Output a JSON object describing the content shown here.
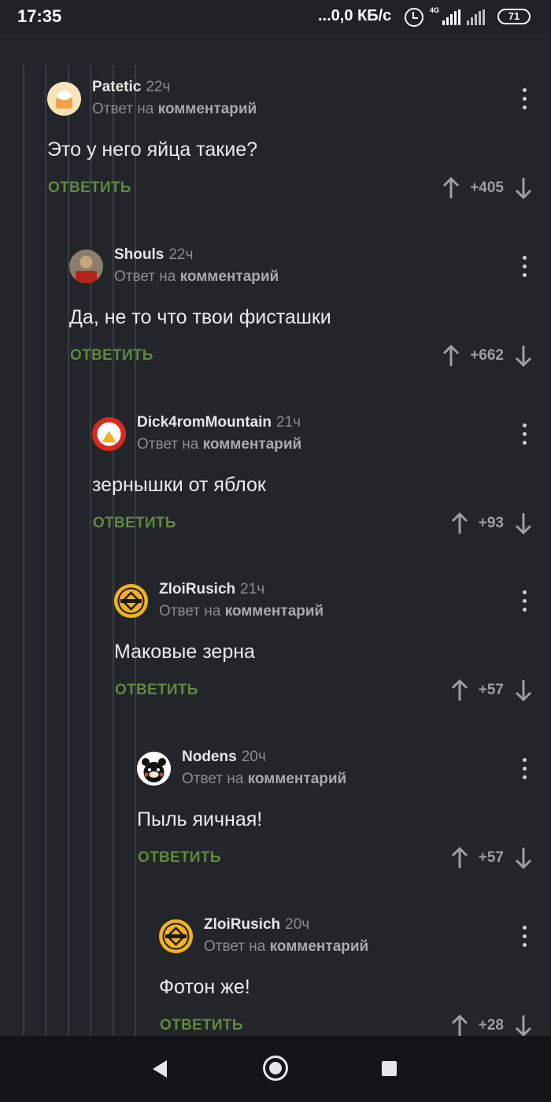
{
  "status_bar": {
    "time": "17:35",
    "network": "...0,0 КБ/с",
    "lte_label": "4G",
    "battery": "71"
  },
  "comments": [
    {
      "user": "Patetic",
      "time": "22ч",
      "reply_prefix": "Ответ на",
      "reply_target": "комментарий",
      "text": "Это у него яйца такие?",
      "reply_label": "ОТВЕТИТЬ",
      "score": "+405",
      "avatar_color": "#f3d9a2"
    },
    {
      "user": "Shouls",
      "time": "22ч",
      "reply_prefix": "Ответ на",
      "reply_target": "комментарий",
      "text": "Да, не то что твои фисташки",
      "reply_label": "ОТВЕТИТЬ",
      "score": "+662",
      "avatar_color": "#7a5a3a"
    },
    {
      "user": "Dick4romMountain",
      "time": "21ч",
      "reply_prefix": "Ответ на",
      "reply_target": "комментарий",
      "text": "зернышки от яблок",
      "reply_label": "ОТВЕТИТЬ",
      "score": "+93",
      "avatar_color": "#d92b1d"
    },
    {
      "user": "ZloiRusich",
      "time": "21ч",
      "reply_prefix": "Ответ на",
      "reply_target": "комментарий",
      "text": "Маковые зерна",
      "reply_label": "ОТВЕТИТЬ",
      "score": "+57",
      "avatar_color": "#f2b21b"
    },
    {
      "user": "Nodens",
      "time": "20ч",
      "reply_prefix": "Ответ на",
      "reply_target": "комментарий",
      "text": "Пыль яичная!",
      "reply_label": "ОТВЕТИТЬ",
      "score": "+57",
      "avatar_color": "#ffffff"
    },
    {
      "user": "ZloiRusich",
      "time": "20ч",
      "reply_prefix": "Ответ на",
      "reply_target": "комментарий",
      "text": "Фотон же!",
      "reply_label": "ОТВЕТИТЬ",
      "score": "+28",
      "avatar_color": "#f2b21b"
    }
  ],
  "icons": {
    "upvote": "arrow-up-icon",
    "downvote": "arrow-down-icon",
    "menu": "more-vertical-icon",
    "back": "back-icon",
    "home": "home-icon",
    "recents": "recents-icon"
  },
  "colors": {
    "background": "#22252a",
    "reply_green": "#5f8a3e",
    "muted": "#8a8d92"
  }
}
